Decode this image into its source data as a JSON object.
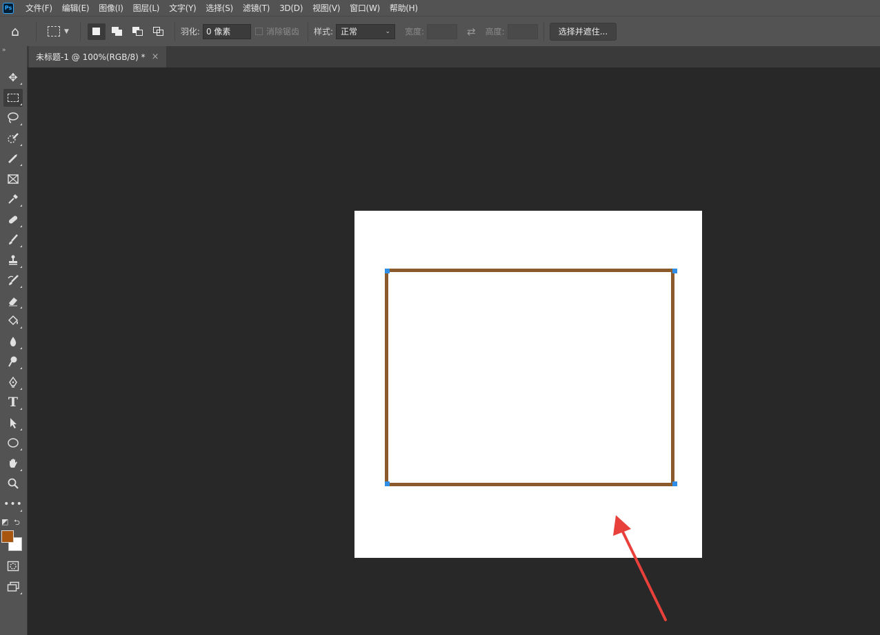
{
  "app": {
    "logo_text": "Ps"
  },
  "menu": [
    "文件(F)",
    "编辑(E)",
    "图像(I)",
    "图层(L)",
    "文字(Y)",
    "选择(S)",
    "滤镜(T)",
    "3D(D)",
    "视图(V)",
    "窗口(W)",
    "帮助(H)"
  ],
  "options": {
    "feather_label": "羽化:",
    "feather_value": "0 像素",
    "antialias_label": "消除锯齿",
    "style_label": "样式:",
    "style_value": "正常",
    "width_label": "宽度:",
    "height_label": "高度:",
    "select_mask_button": "选择并遮住..."
  },
  "document": {
    "tab_title": "未标题-1 @ 100%(RGB/8) *"
  },
  "colors": {
    "foreground": "#a8560f",
    "background": "#ffffff",
    "frame_stroke": "#8a5a2b",
    "anchor": "#2f8fe8",
    "arrow": "#e8403a"
  }
}
